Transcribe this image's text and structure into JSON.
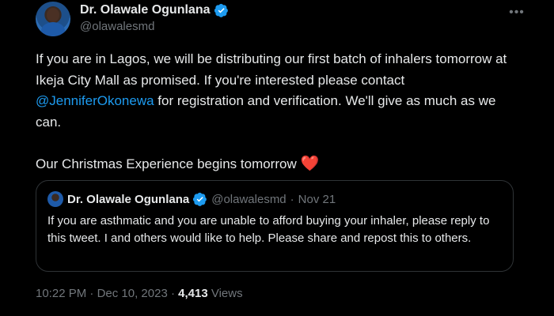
{
  "author": {
    "display_name": "Dr. Olawale Ogunlana",
    "handle": "@olawalesmd"
  },
  "tweet": {
    "text_part1": "If you are in Lagos, we will be distributing our first batch of inhalers tomorrow at Ikeja City Mall as promised. If you're interested please contact ",
    "mention": "@JenniferOkonewa",
    "text_part2": " for registration and verification. We'll give as much as we can.",
    "text_line2": "Our Christmas Experience begins tomorrow ",
    "emoji": "❤️"
  },
  "quoted_tweet": {
    "display_name": "Dr. Olawale Ogunlana",
    "handle": "@olawalesmd",
    "separator": "·",
    "date": "Nov 21",
    "text": "If you are asthmatic and you are unable to afford buying your inhaler, please reply to this tweet. I and others would like to help. Please share and repost this to others."
  },
  "meta": {
    "time": "10:22 PM",
    "separator": "·",
    "date": "Dec 10, 2023",
    "views_count": "4,413",
    "views_label": "Views"
  },
  "icons": {
    "verified": "verified-badge-icon",
    "more": "more-options-icon"
  },
  "colors": {
    "background": "#000000",
    "text": "#e7e9ea",
    "secondary": "#71767b",
    "accent": "#1d9bf0",
    "heart": "#f91880"
  }
}
